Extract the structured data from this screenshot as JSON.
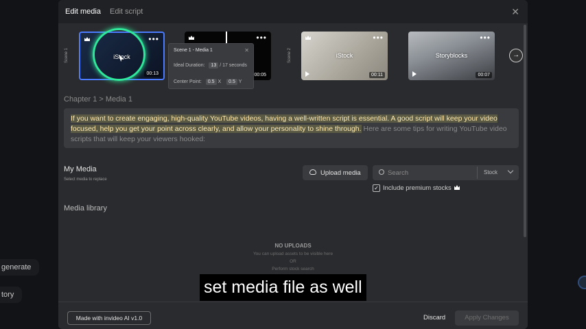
{
  "background": {
    "left_items": [
      "generate",
      "tory"
    ]
  },
  "modal": {
    "tabs": [
      "Edit media",
      "Edit script"
    ],
    "scenes": [
      {
        "label": "Scene 1",
        "media": [
          {
            "source": "iStock",
            "duration": "00:13",
            "premium": true,
            "active": true
          },
          {
            "source": "",
            "duration": "00:05",
            "premium": true,
            "active": false
          }
        ]
      },
      {
        "label": "Scene 2",
        "media": [
          {
            "source": "iStock",
            "duration": "00:11",
            "premium": true,
            "active": false
          },
          {
            "source": "Storyblocks",
            "duration": "00:07",
            "premium": false,
            "active": false
          }
        ]
      }
    ],
    "popover": {
      "title": "Scene 1 - Media 1",
      "ideal_duration_label": "Ideal Duration:",
      "ideal_duration_value": "13",
      "ideal_duration_total": "/ 17 seconds",
      "center_point_label": "Center Point:",
      "x_value": "0.5",
      "x_label": "X",
      "y_value": "0.5",
      "y_label": "Y"
    },
    "breadcrumb": "Chapter 1 > Media 1",
    "script_highlighted": "If you want to create engaging, high-quality YouTube videos, having a well-written script is essential. A good script will keep your video focused, help you get your point across clearly, and allow your personality to shine through.",
    "script_rest": " Here are some tips for writing YouTube video scripts that will keep your viewers hooked:",
    "my_media": {
      "title": "My Media",
      "subtitle": "Select media to replace",
      "upload_label": "Upload media",
      "search_placeholder": "Search",
      "source_select": "Stock",
      "premium_checkbox_label": "Include premium stocks",
      "premium_checked": true
    },
    "media_library": {
      "title": "Media library",
      "empty_title": "NO UPLOADS",
      "empty_line1": "You can upload assets to be visible here",
      "empty_line2": "OR",
      "empty_line3": "Perform stock search"
    },
    "footer": {
      "made_with": "Made with invideo AI v1.0",
      "discard": "Discard",
      "apply": "Apply Changes"
    }
  },
  "caption": "set media file as well",
  "colors": {
    "accent_ring": "#2fe89a",
    "active_border": "#4b7bff",
    "highlight": "#ffe9b0"
  }
}
